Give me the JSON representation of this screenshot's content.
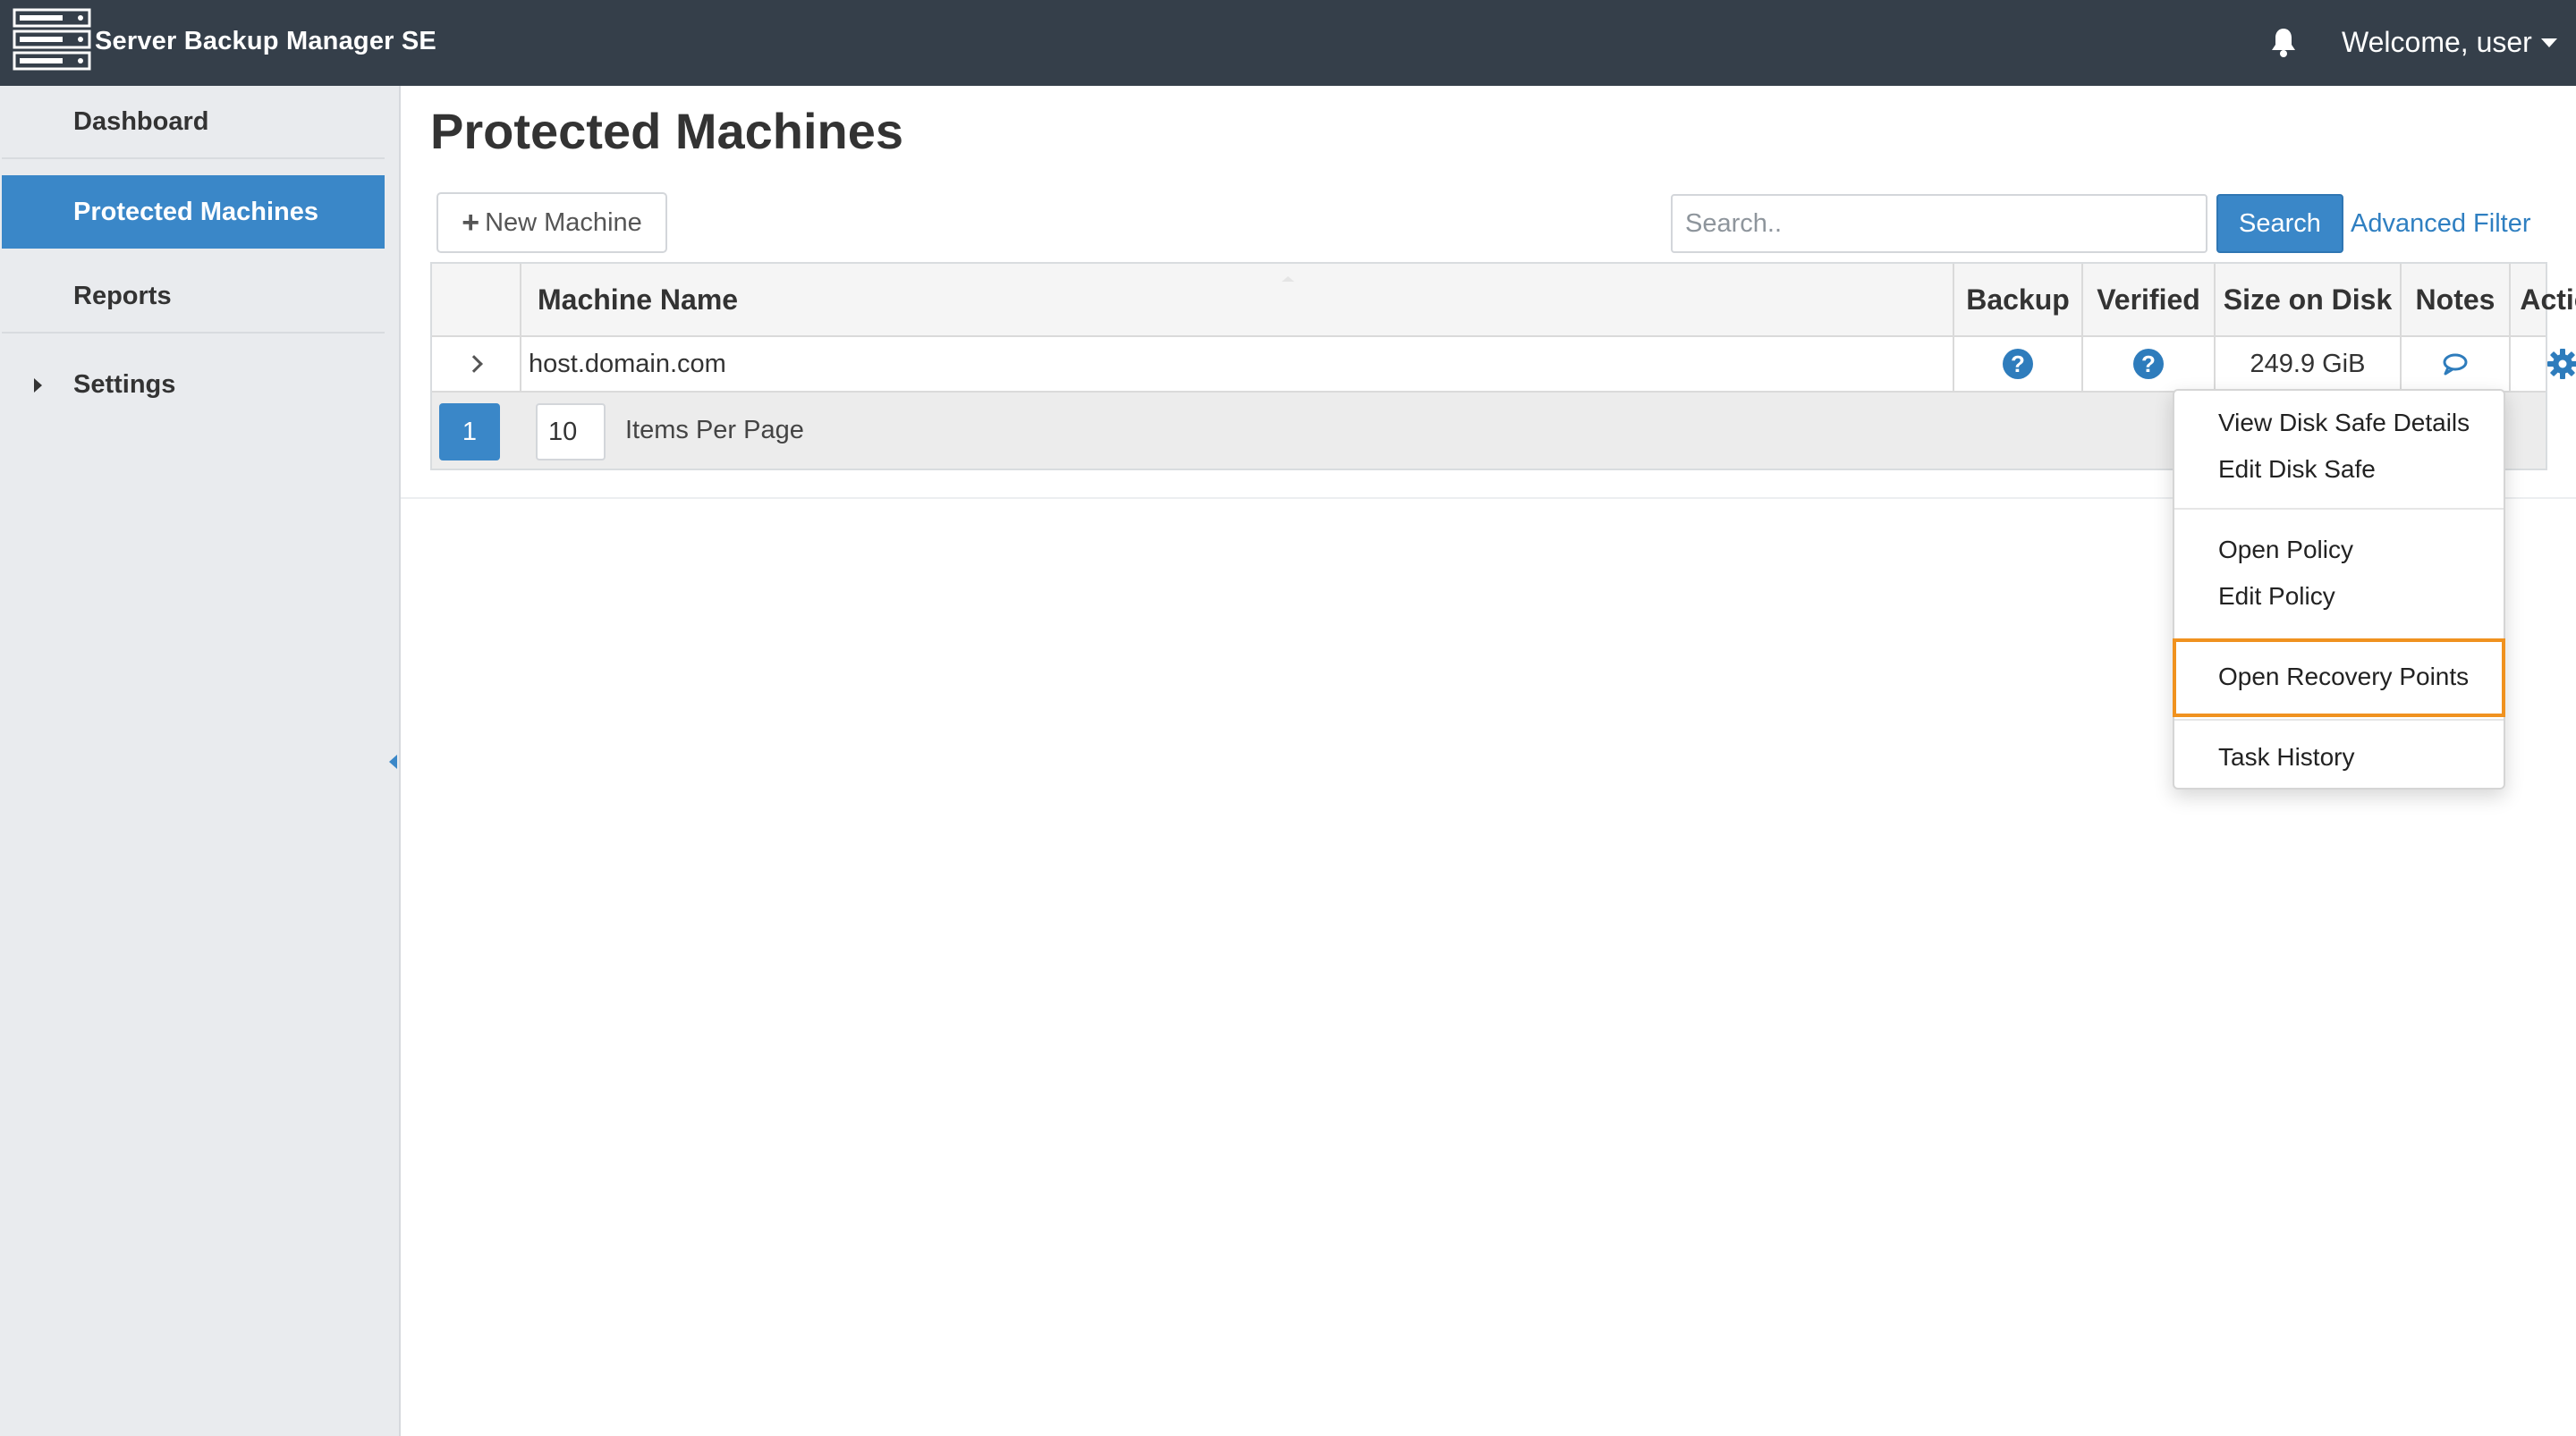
{
  "app": {
    "title": "Server Backup Manager SE",
    "welcome": "Welcome, user",
    "colors": {
      "topbar": "#353f4a",
      "accent": "#3a87c8",
      "highlight": "#f0921f"
    },
    "icons": {
      "logo": "server-stack-icon",
      "notifications": "bell-icon"
    }
  },
  "sidebar": {
    "items": [
      {
        "label": "Dashboard"
      },
      {
        "label": "Protected Machines"
      },
      {
        "label": "Reports"
      },
      {
        "label": "Settings"
      }
    ]
  },
  "page": {
    "title": "Protected Machines",
    "new_machine_label": "New Machine",
    "search_placeholder": "Search..",
    "search_label": "Search",
    "advanced_filter_label": "Advanced Filter"
  },
  "table": {
    "columns": [
      "",
      "Machine Name",
      "Backup",
      "Verified",
      "Size on Disk",
      "Notes",
      "Actions"
    ],
    "rows": [
      {
        "machine_name": "host.domain.com",
        "backup": "?",
        "verified": "?",
        "size_on_disk": "249.9 GiB"
      }
    ],
    "pager": {
      "page": "1",
      "per_page": "10",
      "per_page_label": "Items Per Page"
    }
  },
  "actions_menu": {
    "items": [
      "View Disk Safe Details",
      "Edit Disk Safe",
      "Open Policy",
      "Edit Policy",
      "Open Recovery Points",
      "Task History"
    ],
    "highlighted": "Open Recovery Points"
  }
}
